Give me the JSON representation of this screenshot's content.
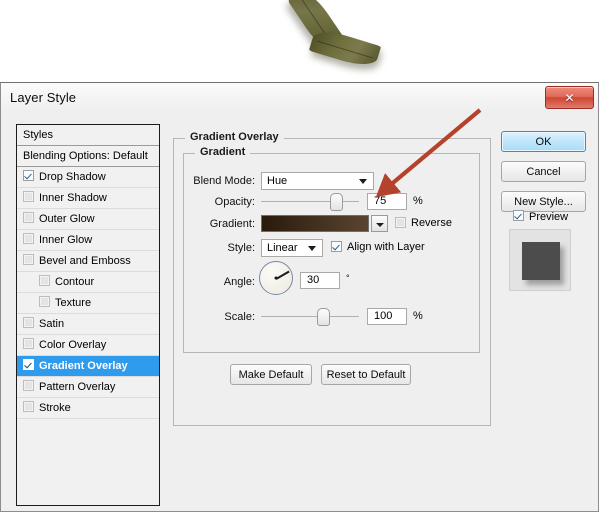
{
  "canvas": {
    "leaves": [
      {
        "name": "bay-leaf-upper"
      },
      {
        "name": "bay-leaf-lower"
      }
    ]
  },
  "dialog": {
    "title": "Layer Style",
    "close_label": "✕"
  },
  "styles_list": {
    "header": "Styles",
    "blending_options": "Blending Options: Default",
    "items": [
      {
        "label": "Drop Shadow",
        "checked": true,
        "indent": false
      },
      {
        "label": "Inner Shadow",
        "checked": false,
        "indent": false
      },
      {
        "label": "Outer Glow",
        "checked": false,
        "indent": false
      },
      {
        "label": "Inner Glow",
        "checked": false,
        "indent": false
      },
      {
        "label": "Bevel and Emboss",
        "checked": false,
        "indent": false
      },
      {
        "label": "Contour",
        "checked": false,
        "indent": true
      },
      {
        "label": "Texture",
        "checked": false,
        "indent": true
      },
      {
        "label": "Satin",
        "checked": false,
        "indent": false
      },
      {
        "label": "Color Overlay",
        "checked": false,
        "indent": false
      },
      {
        "label": "Gradient Overlay",
        "checked": true,
        "indent": false,
        "selected": true
      },
      {
        "label": "Pattern Overlay",
        "checked": false,
        "indent": false
      },
      {
        "label": "Stroke",
        "checked": false,
        "indent": false
      }
    ]
  },
  "panel": {
    "legend_outer": "Gradient Overlay",
    "legend_inner": "Gradient",
    "blend_mode": {
      "label": "Blend Mode:",
      "value": "Hue"
    },
    "opacity": {
      "label": "Opacity:",
      "value": "75",
      "unit": "%",
      "percent": 75
    },
    "gradient": {
      "label": "Gradient:",
      "from": "#2a1a0c",
      "to": "#5a4430"
    },
    "reverse": {
      "label": "Reverse",
      "checked": false
    },
    "style": {
      "label": "Style:",
      "value": "Linear"
    },
    "align_with_layer": {
      "label": "Align with Layer",
      "checked": true
    },
    "angle": {
      "label": "Angle:",
      "value": "30",
      "unit": "°",
      "degrees": 30
    },
    "scale": {
      "label": "Scale:",
      "value": "100",
      "unit": "%",
      "percent": 100
    },
    "make_default": "Make Default",
    "reset_to_default": "Reset to Default"
  },
  "right": {
    "ok": "OK",
    "cancel": "Cancel",
    "new_style": "New Style...",
    "preview": {
      "label": "Preview",
      "checked": true
    }
  },
  "annotation": {
    "arrow_color": "#b5432c",
    "points_to": "opacity-value-field"
  },
  "colors": {
    "selection_blue": "#2f9bec",
    "close_red": "#cf4432",
    "dialog_bg": "#efeff0"
  }
}
